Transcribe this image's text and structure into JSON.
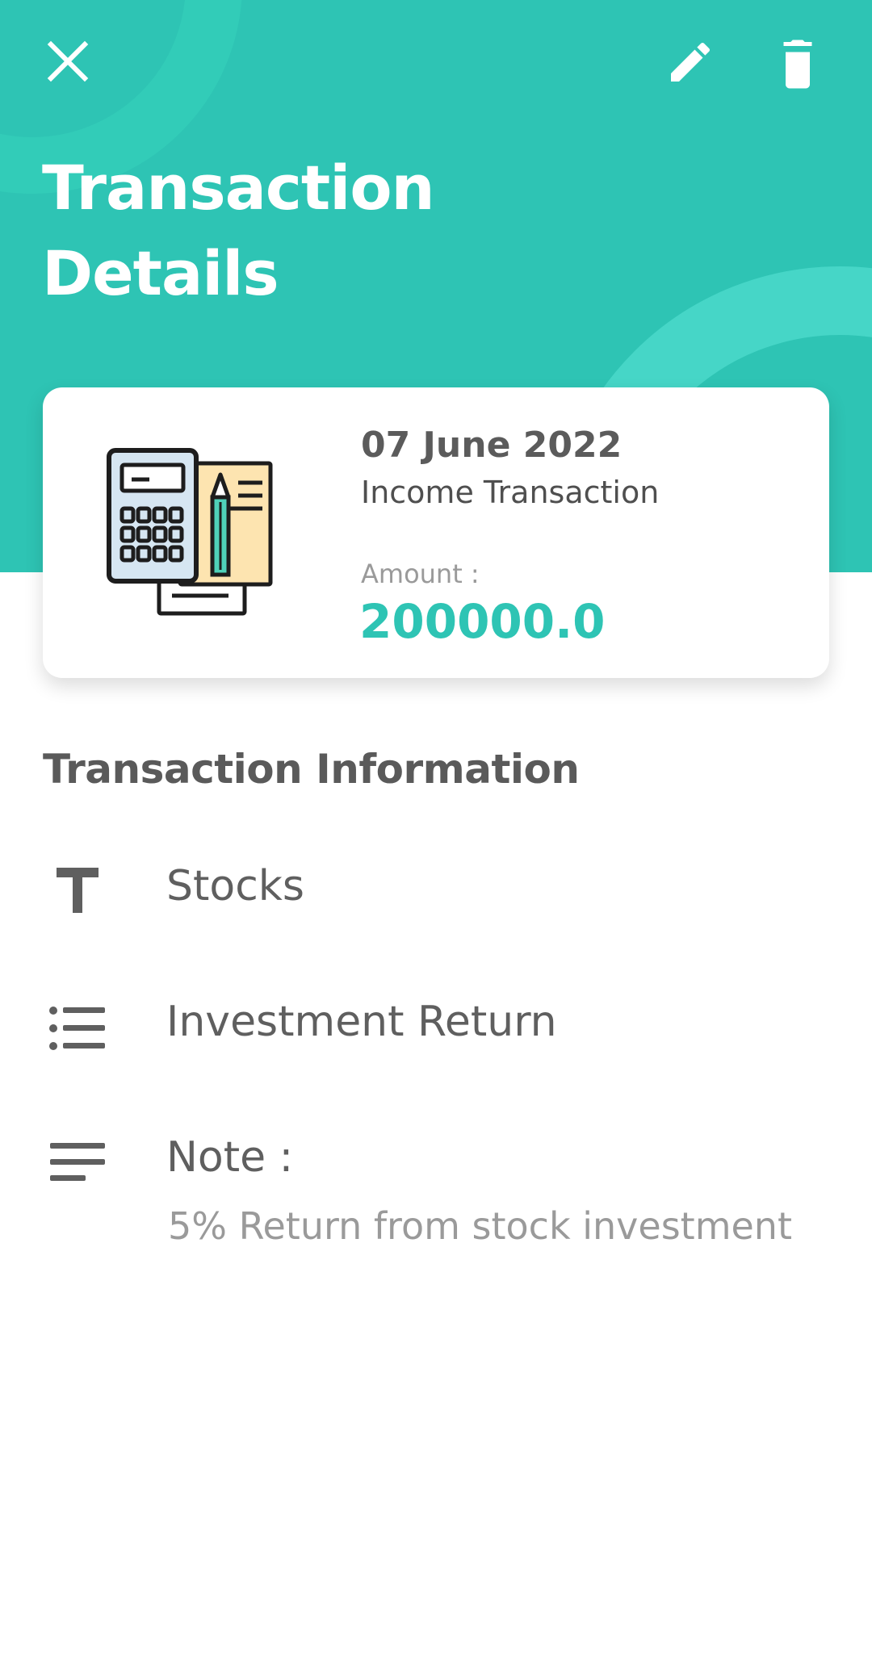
{
  "colors": {
    "accent": "#2ec4b4",
    "header_bg": "#2ec4b4",
    "text_dark": "#5a5a5a",
    "text_muted": "#9a9a9a"
  },
  "header": {
    "title_line1": "Transaction",
    "title_line2": "Details",
    "icons": {
      "close": "close-icon",
      "edit": "pencil-icon",
      "delete": "trash-icon"
    }
  },
  "summary_card": {
    "illustration": "calculator-document-icon",
    "date": "07 June 2022",
    "type": "Income Transaction",
    "amount_label": "Amount :",
    "amount": "200000.0"
  },
  "info": {
    "section_title": "Transaction Information",
    "category": "Stocks",
    "subcategory": "Investment Return",
    "note_label": "Note :",
    "note": "5% Return from stock investment"
  }
}
